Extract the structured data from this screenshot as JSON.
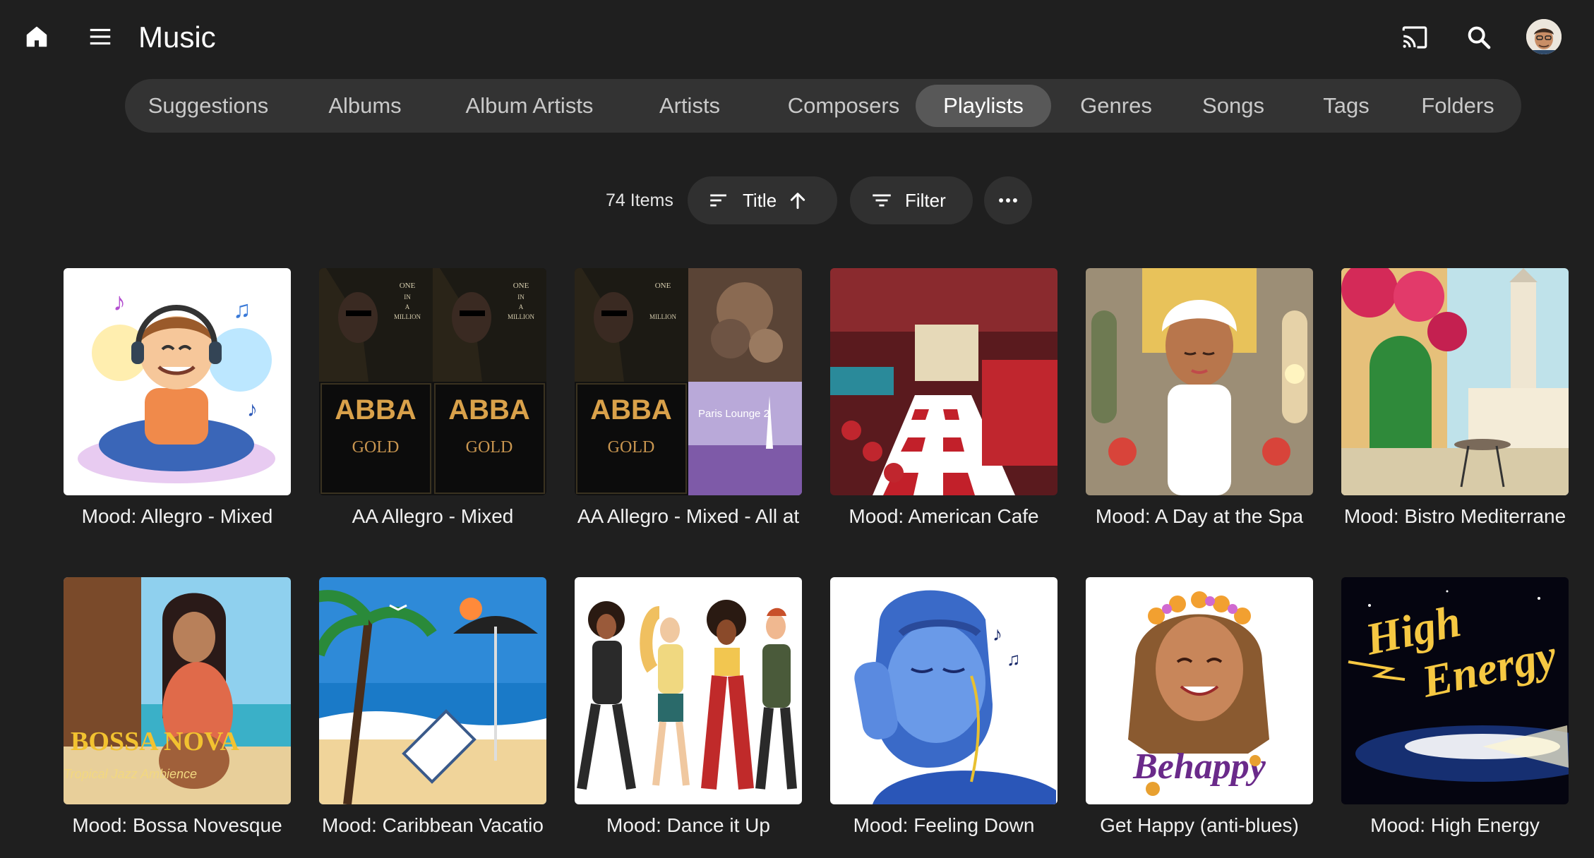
{
  "app": {
    "title": "Music"
  },
  "tabs": [
    {
      "label": "Suggestions"
    },
    {
      "label": "Albums"
    },
    {
      "label": "Album Artists"
    },
    {
      "label": "Artists"
    },
    {
      "label": "Composers"
    },
    {
      "label": "Playlists",
      "active": true
    },
    {
      "label": "Genres"
    },
    {
      "label": "Songs"
    },
    {
      "label": "Tags"
    },
    {
      "label": "Folders"
    }
  ],
  "toolbar": {
    "item_count": "74 Items",
    "sort_label": "Title",
    "filter_label": "Filter"
  },
  "playlists": [
    {
      "title": "Mood: Allegro - Mixed"
    },
    {
      "title": "AA Allegro - Mixed"
    },
    {
      "title": "AA Allegro - Mixed - All at"
    },
    {
      "title": "Mood: American Cafe"
    },
    {
      "title": "Mood: A Day at the Spa"
    },
    {
      "title": "Mood: Bistro Mediterrane"
    },
    {
      "title": "Mood: Bossa Novesque"
    },
    {
      "title": "Mood: Caribbean Vacatio"
    },
    {
      "title": "Mood: Dance it Up"
    },
    {
      "title": "Mood: Feeling Down"
    },
    {
      "title": "Get Happy (anti-blues)"
    },
    {
      "title": "Mood: High Energy"
    }
  ],
  "cover_text": {
    "abba": "ABBA",
    "gold": "GOLD",
    "one_in_a_million": "ONE IN A MILLION",
    "paris_lounge": "Paris Lounge 2",
    "bossa_nova": "BOSSA NOVA",
    "bossa_sub": "Tropical Jazz Ambience",
    "behappy": "Behappy",
    "high_energy_1": "High",
    "high_energy_2": "Energy"
  },
  "icons": {
    "home": "home-icon",
    "menu": "menu-icon",
    "cast": "cast-icon",
    "search": "search-icon",
    "avatar": "avatar",
    "sort": "sort-icon",
    "arrow_up": "arrow-up-icon",
    "filter": "filter-icon",
    "more": "more-icon"
  }
}
